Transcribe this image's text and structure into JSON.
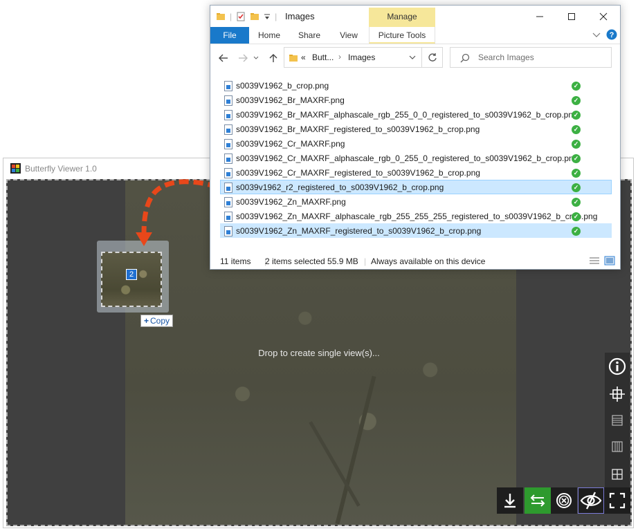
{
  "viewer": {
    "title": "Butterfly Viewer 1.0",
    "drop_hint": "Drop to create single view(s)...",
    "drag_count": "2",
    "copy_tip": "Copy"
  },
  "explorer": {
    "window_title": "Images",
    "manage_label": "Manage",
    "ribbon_tabs": [
      "File",
      "Home",
      "Share",
      "View",
      "Picture Tools"
    ],
    "address": {
      "chevrons": "«",
      "crumb_parent": "Butt...",
      "crumb_current": "Images"
    },
    "search_placeholder": "Search Images",
    "files": [
      "s0039V1962_b_crop.png",
      "s0039V1962_Br_MAXRF.png",
      "s0039V1962_Br_MAXRF_alphascale_rgb_255_0_0_registered_to_s0039V1962_b_crop.png",
      "s0039V1962_Br_MAXRF_registered_to_s0039V1962_b_crop.png",
      "s0039V1962_Cr_MAXRF.png",
      "s0039V1962_Cr_MAXRF_alphascale_rgb_0_255_0_registered_to_s0039V1962_b_crop.png",
      "s0039V1962_Cr_MAXRF_registered_to_s0039V1962_b_crop.png",
      "s0039v1962_r2_registered_to_s0039V1962_b_crop.png",
      "s0039V1962_Zn_MAXRF.png",
      "s0039V1962_Zn_MAXRF_alphascale_rgb_255_255_255_registered_to_s0039V1962_b_crop.png",
      "s0039V1962_Zn_MAXRF_registered_to_s0039V1962_b_crop.png"
    ],
    "status": {
      "item_count": "11 items",
      "selected": "2 items selected  55.9 MB",
      "availability": "Always available on this device"
    }
  },
  "colors": {
    "file_tab": "#1979ca",
    "manage_tab": "#f6e79a",
    "selection": "#cce8ff",
    "sync_ok": "#3cb043",
    "drag_arrow": "#e8471a",
    "swap_button": "#2e9a2e"
  },
  "icons": {
    "side_toolbar": [
      "info-icon",
      "crosshair-icon",
      "horizontal-split-icon",
      "vertical-split-icon",
      "grid-icon"
    ],
    "bottom_toolbar": [
      "download-icon",
      "swap-icon",
      "close-all-icon",
      "hide-interface-icon",
      "fullscreen-icon"
    ]
  }
}
